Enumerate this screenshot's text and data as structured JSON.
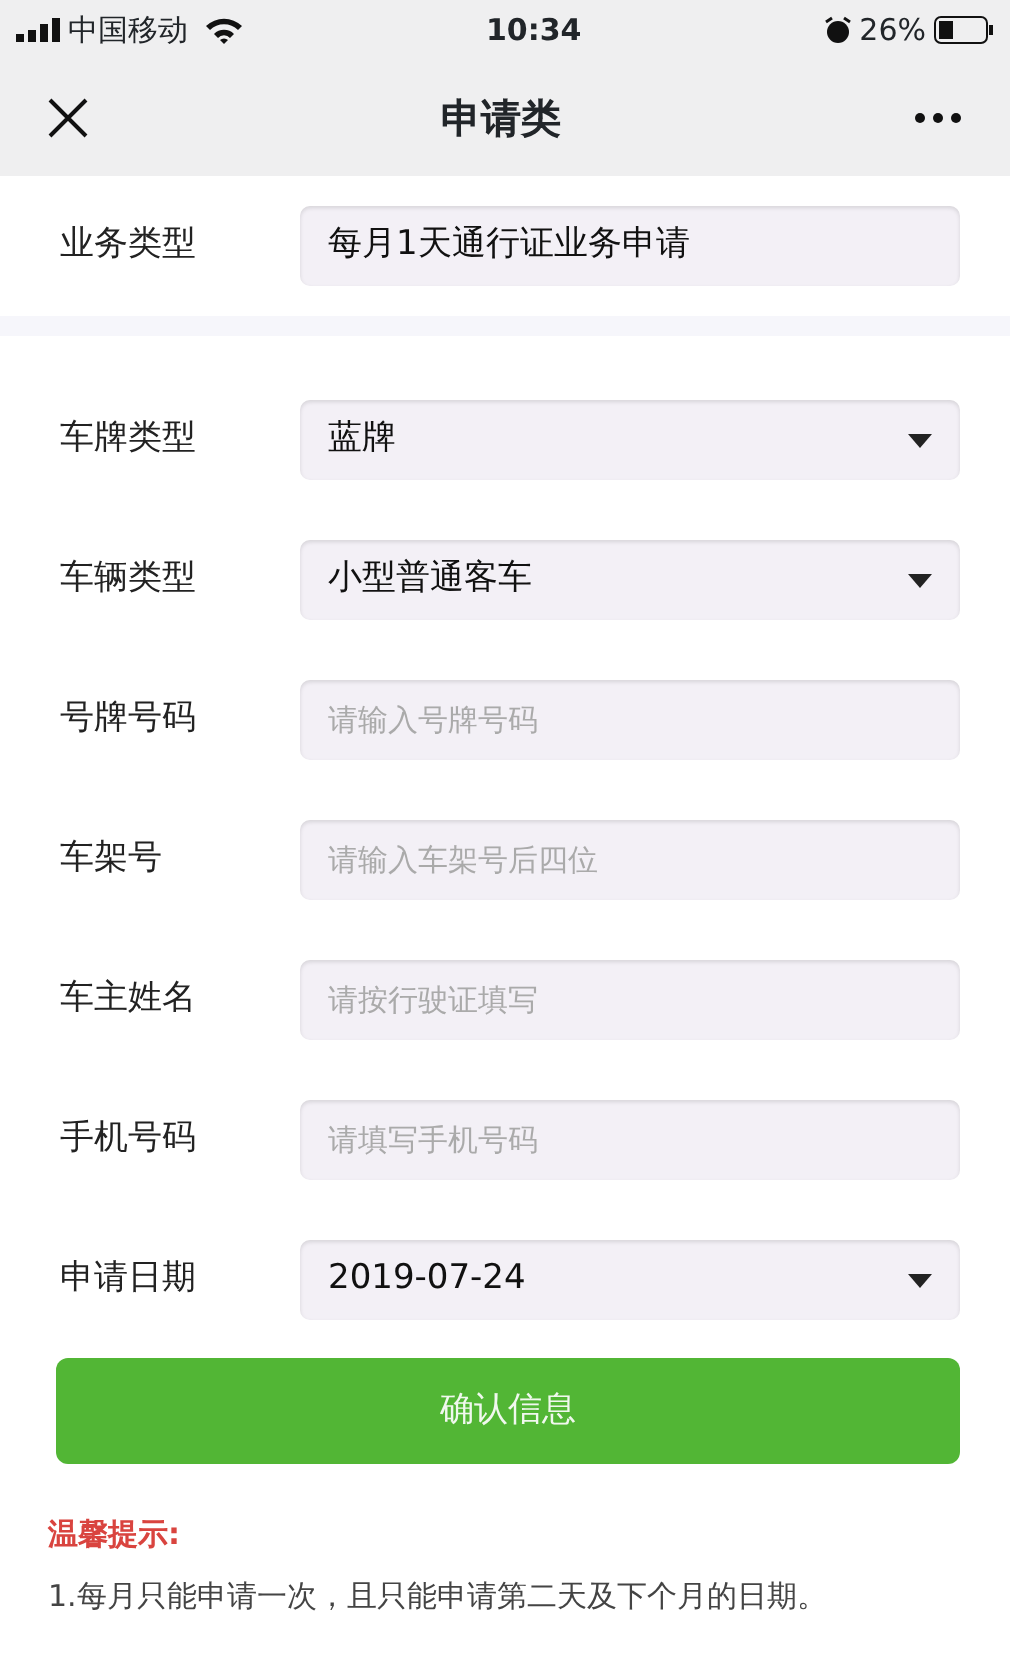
{
  "status_bar": {
    "carrier": "中国移动",
    "time": "10:34",
    "battery": "26%"
  },
  "nav": {
    "title": "申请类"
  },
  "business": {
    "label": "业务类型",
    "value": "每月1天通行证业务申请"
  },
  "fields": [
    {
      "label": "车牌类型",
      "kind": "select",
      "value": "蓝牌"
    },
    {
      "label": "车辆类型",
      "kind": "select",
      "value": "小型普通客车"
    },
    {
      "label": "号牌号码",
      "kind": "input",
      "placeholder": "请输入号牌号码"
    },
    {
      "label": "车架号",
      "kind": "input",
      "placeholder": "请输入车架号后四位"
    },
    {
      "label": "车主姓名",
      "kind": "input",
      "placeholder": "请按行驶证填写"
    },
    {
      "label": "手机号码",
      "kind": "input",
      "placeholder": "请填写手机号码"
    },
    {
      "label": "申请日期",
      "kind": "select",
      "value": "2019-07-24"
    }
  ],
  "submit": "确认信息",
  "tips": {
    "title": "温馨提示:",
    "items": [
      "1.每月只能申请一次，且只能申请第二天及下个月的日期。"
    ]
  }
}
